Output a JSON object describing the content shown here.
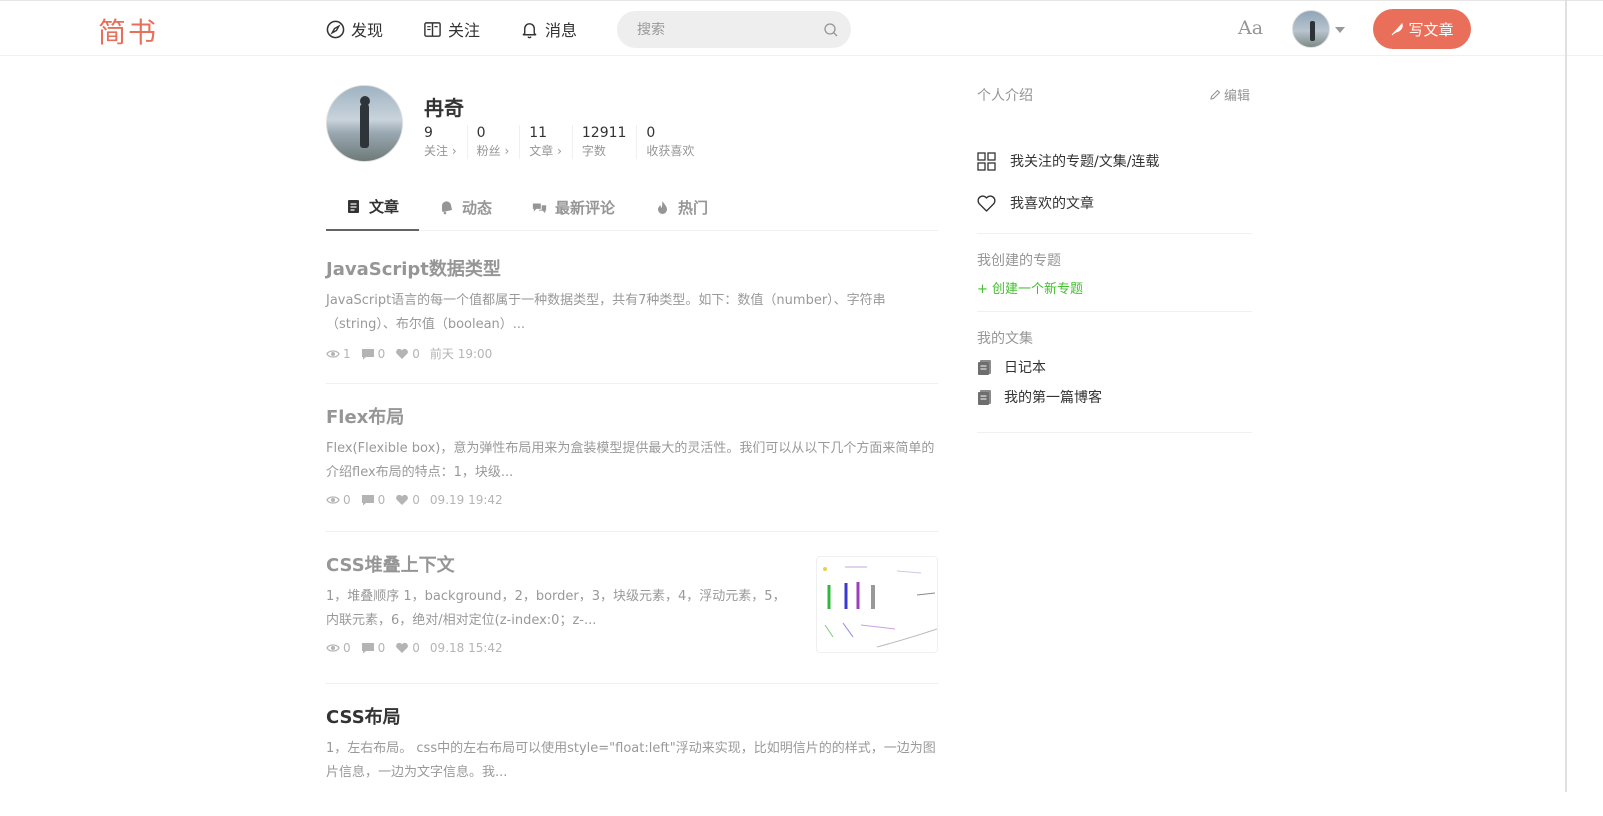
{
  "header": {
    "logo": "简书",
    "nav": [
      {
        "label": "发现",
        "icon": "compass-icon"
      },
      {
        "label": "关注",
        "icon": "book-icon"
      },
      {
        "label": "消息",
        "icon": "bell-icon"
      }
    ],
    "search_placeholder": "搜索",
    "font_toggle": "Aa",
    "write_label": "写文章",
    "accent_color": "#ea6f5a"
  },
  "profile": {
    "name": "冉奇",
    "stats": [
      {
        "value": "9",
        "label": "关注 ›"
      },
      {
        "value": "0",
        "label": "粉丝 ›"
      },
      {
        "value": "11",
        "label": "文章 ›"
      },
      {
        "value": "12911",
        "label": "字数"
      },
      {
        "value": "0",
        "label": "收获喜欢"
      }
    ]
  },
  "tabs": [
    {
      "label": "文章",
      "icon": "document-icon",
      "active": true
    },
    {
      "label": "动态",
      "icon": "bell-icon"
    },
    {
      "label": "最新评论",
      "icon": "comments-icon"
    },
    {
      "label": "热门",
      "icon": "fire-icon"
    }
  ],
  "articles": [
    {
      "title": "JavaScript数据类型",
      "abstract": "JavaScript语言的每一个值都属于一种数据类型，共有7种类型。如下：数值（number）、字符串（string）、布尔值（boolean）...",
      "views": "1",
      "comments": "0",
      "likes": "0",
      "time": "前天 19:00"
    },
    {
      "title": "Flex布局",
      "abstract": "Flex(Flexible box)，意为弹性布局用来为盒装模型提供最大的灵活性。我们可以从以下几个方面来简单的介绍flex布局的特点：1，块级...",
      "views": "0",
      "comments": "0",
      "likes": "0",
      "time": "09.19 19:42"
    },
    {
      "title": "CSS堆叠上下文",
      "abstract": "1，堆叠顺序 1，background，2，border，3，块级元素，4，浮动元素，5，内联元素，6，绝对/相对定位(z-index:0；z-...",
      "views": "0",
      "comments": "0",
      "likes": "0",
      "time": "09.18 15:42"
    },
    {
      "title": "CSS布局",
      "abstract": "1，左右布局。 css中的左右布局可以使用style=\"float:left\"浮动来实现，比如明信片的的样式，一边为图片信息，一边为文字信息。我..."
    }
  ],
  "sidebar": {
    "intro_title": "个人介绍",
    "edit_label": "编辑",
    "links": [
      {
        "label": "我关注的专题/文集/连载",
        "icon": "grid-icon"
      },
      {
        "label": "我喜欢的文章",
        "icon": "heart-icon"
      }
    ],
    "topics_title": "我创建的专题",
    "create_topic": "+ 创建一个新专题",
    "notebooks_title": "我的文集",
    "notebooks": [
      "日记本",
      "我的第一篇博客"
    ]
  }
}
